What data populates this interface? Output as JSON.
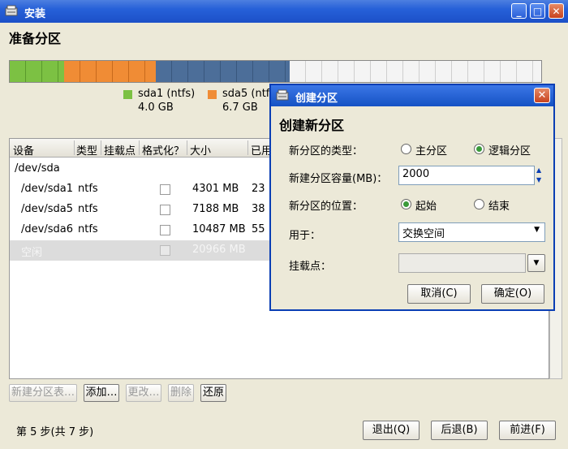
{
  "window": {
    "title": "安装"
  },
  "page": {
    "title": "准备分区"
  },
  "partition_bar": {
    "segments": [
      {
        "name": "sda1",
        "color": "#7cc143",
        "fraction": 0.103
      },
      {
        "name": "sda5",
        "color": "#f08c35",
        "fraction": 0.172
      },
      {
        "name": "sda6",
        "color": "#4c6e99",
        "fraction": 0.251
      },
      {
        "name": "free",
        "color": "#f4f4f4",
        "fraction": 0.474
      }
    ],
    "legend": [
      {
        "label": "sda1 (ntfs)",
        "size": "4.0 GB",
        "color": "#7cc143"
      },
      {
        "label": "sda5 (ntfs",
        "size": "6.7 GB",
        "color": "#f08c35"
      }
    ]
  },
  "table": {
    "headers": [
      "设备",
      "类型",
      "挂载点",
      "格式化？",
      "大小",
      "已用"
    ],
    "rows": [
      {
        "device": "/dev/sda",
        "type": "",
        "size": "",
        "used": "",
        "checkbox": false
      },
      {
        "device": "/dev/sda1",
        "type": "ntfs",
        "size": "4301 MB",
        "used": "23",
        "checkbox": true
      },
      {
        "device": "/dev/sda5",
        "type": "ntfs",
        "size": "7188 MB",
        "used": "38",
        "checkbox": true
      },
      {
        "device": "/dev/sda6",
        "type": "ntfs",
        "size": "10487 MB",
        "used": "55",
        "checkbox": true
      },
      {
        "device": "空闲",
        "type": "",
        "size": "20966 MB",
        "used": "",
        "checkbox": true
      }
    ]
  },
  "toolbar": {
    "new_table": "新建分区表…",
    "add": "添加…",
    "change": "更改…",
    "delete": "删除",
    "revert": "还原"
  },
  "footer": {
    "step": "第 5 步(共 7 步)",
    "quit": "退出(Q)",
    "back": "后退(B)",
    "forward": "前进(F)"
  },
  "dialog": {
    "title": "创建分区",
    "heading": "创建新分区",
    "type_label": "新分区的类型：",
    "type_primary": "主分区",
    "type_logical": "逻辑分区",
    "size_label": "新建分区容量(MB)：",
    "size_value": "2000",
    "position_label": "新分区的位置：",
    "position_start": "起始",
    "position_end": "结束",
    "use_label": "用于：",
    "use_value": "交换空间",
    "mount_label": "挂载点：",
    "mount_value": "",
    "cancel": "取消(C)",
    "ok": "确定(O)"
  }
}
